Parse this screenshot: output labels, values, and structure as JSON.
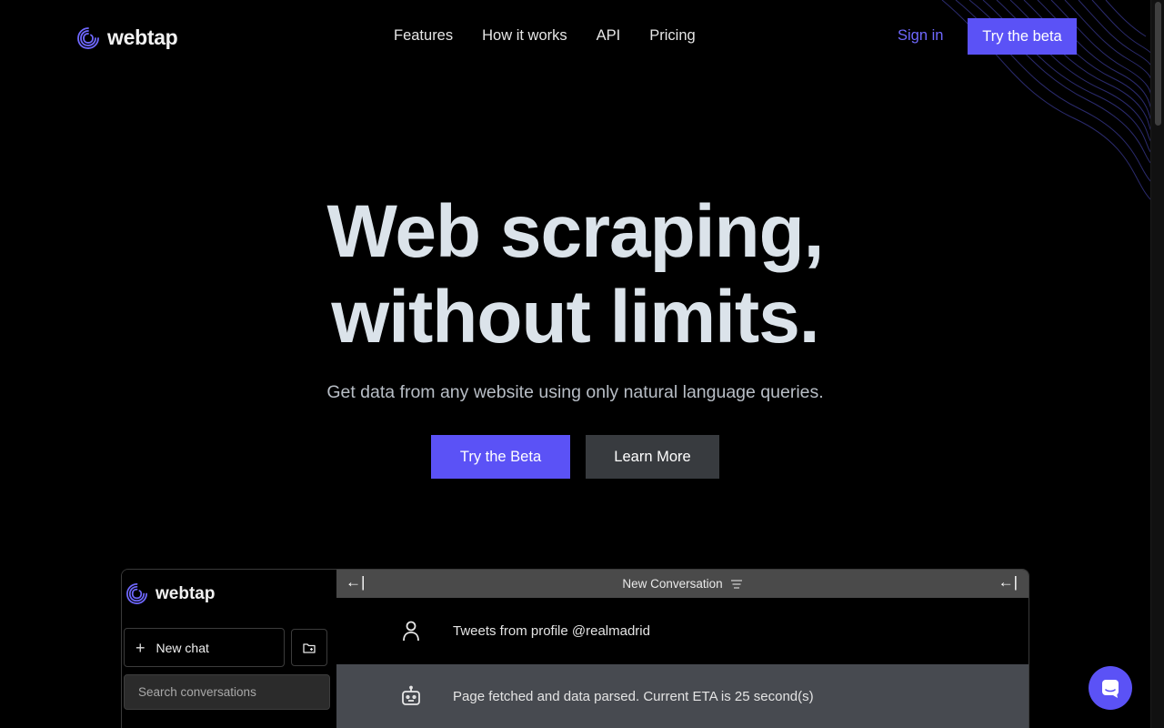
{
  "brand": {
    "name": "webtap",
    "accent": "#5b52f6",
    "link": "#6f68ff"
  },
  "nav": {
    "links": [
      "Features",
      "How it works",
      "API",
      "Pricing"
    ],
    "signin": "Sign in",
    "cta": "Try the beta"
  },
  "hero": {
    "title_line1": "Web scraping,",
    "title_line2": "without limits.",
    "subtitle": "Get data from any website using only natural language queries.",
    "primary_cta": "Try the Beta",
    "secondary_cta": "Learn More"
  },
  "preview": {
    "logo": "webtap",
    "new_chat": "New chat",
    "search_placeholder": "Search conversations",
    "header_title": "New Conversation",
    "messages": [
      {
        "role": "user",
        "icon": "user-icon",
        "text": "Tweets from profile @realmadrid"
      },
      {
        "role": "bot",
        "icon": "robot-icon",
        "text": "Page fetched and data parsed. Current ETA is 25 second(s)"
      }
    ]
  }
}
